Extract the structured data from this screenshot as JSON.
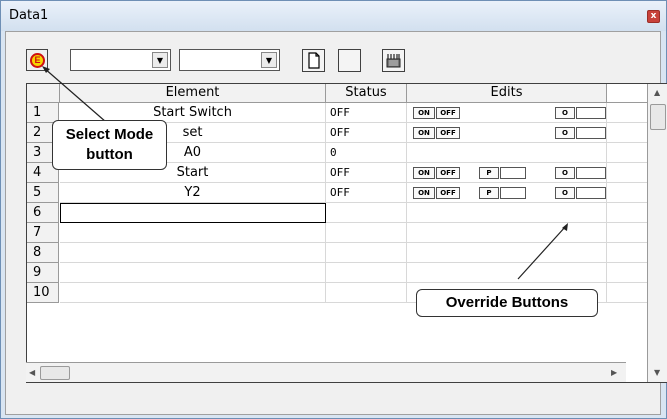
{
  "window": {
    "title": "Data1",
    "close_label": "x"
  },
  "toolbar": {
    "mode_icon_letter": "E",
    "combo1_value": "",
    "combo2_value": "",
    "combo_arrow": "▼"
  },
  "grid": {
    "headers": {
      "element": "Element",
      "status": "Status",
      "edits": "Edits"
    },
    "rows": [
      {
        "num": "1",
        "element": "Start Switch",
        "status": "OFF",
        "buttons": [
          "ON",
          "OFF",
          "O"
        ]
      },
      {
        "num": "2",
        "element": "set",
        "status": "OFF",
        "buttons": [
          "ON",
          "OFF",
          "O"
        ]
      },
      {
        "num": "3",
        "element": "A0",
        "status": "0",
        "buttons": []
      },
      {
        "num": "4",
        "element": "Start",
        "status": "OFF",
        "buttons": [
          "ON",
          "OFF",
          "P",
          "O"
        ]
      },
      {
        "num": "5",
        "element": "Y2",
        "status": "OFF",
        "buttons": [
          "ON",
          "OFF",
          "P",
          "O"
        ]
      },
      {
        "num": "6",
        "element": "",
        "status": "",
        "buttons": []
      },
      {
        "num": "7",
        "element": "",
        "status": "",
        "buttons": []
      },
      {
        "num": "8",
        "element": "",
        "status": "",
        "buttons": []
      },
      {
        "num": "9",
        "element": "",
        "status": "",
        "buttons": []
      },
      {
        "num": "10",
        "element": "",
        "status": "",
        "buttons": []
      }
    ]
  },
  "callouts": {
    "select_mode_line1": "Select Mode",
    "select_mode_line2": "button",
    "override": "Override Buttons"
  }
}
